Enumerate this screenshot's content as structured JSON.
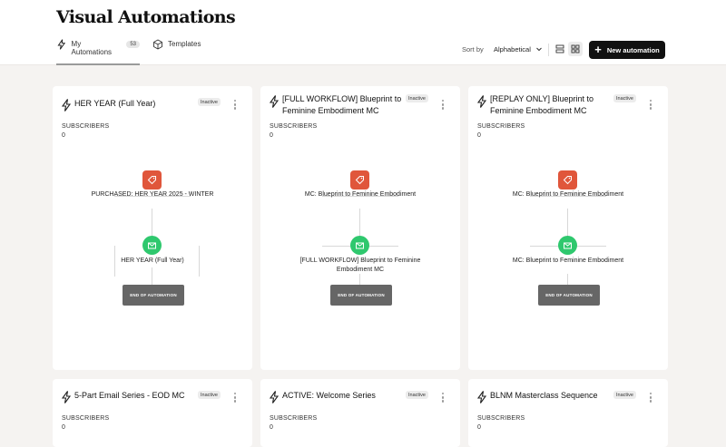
{
  "page": {
    "title": "Visual Automations"
  },
  "tabs": [
    {
      "label": "My Automations",
      "count": "53"
    },
    {
      "label": "Templates"
    }
  ],
  "toolbar": {
    "sort_label": "Sort by",
    "sort_value": "Alphabetical",
    "new_button": "New automation"
  },
  "cards": [
    {
      "title": "HER YEAR (Full Year)",
      "status": "Inactive",
      "subscribers_label": "SUBSCRIBERS",
      "subscribers": "0",
      "trigger": "PURCHASED: HER YEAR 2025 - WINTER",
      "action": "HER YEAR (Full Year)",
      "end": "END OF AUTOMATION"
    },
    {
      "title": "[FULL WORKFLOW] Blueprint to Feminine Embodiment MC",
      "status": "Inactive",
      "subscribers_label": "SUBSCRIBERS",
      "subscribers": "0",
      "trigger": "MC: Blueprint to Feminine Embodiment",
      "action": "[FULL WORKFLOW] Blueprint to Feminine Embodiment MC",
      "end": "END OF AUTOMATION"
    },
    {
      "title": "[REPLAY ONLY] Blueprint to Feminine Embodiment MC",
      "status": "Inactive",
      "subscribers_label": "SUBSCRIBERS",
      "subscribers": "0",
      "trigger": "MC: Blueprint to Feminine Embodiment",
      "action": "MC: Blueprint to Feminine Embodiment",
      "end": "END OF AUTOMATION"
    },
    {
      "title": "5-Part Email Series - EOD MC",
      "status": "Inactive",
      "subscribers_label": "SUBSCRIBERS",
      "subscribers": "0"
    },
    {
      "title": "ACTIVE: Welcome Series",
      "status": "Inactive",
      "subscribers_label": "SUBSCRIBERS",
      "subscribers": "0"
    },
    {
      "title": "BLNM Masterclass Sequence",
      "status": "Inactive",
      "subscribers_label": "SUBSCRIBERS",
      "subscribers": "0"
    }
  ],
  "colors": {
    "trigger": "#e0563b",
    "action": "#2fc86e",
    "primary_button": "#111111",
    "end_node": "#666666"
  },
  "icons": [
    "bolt-icon",
    "cube-icon",
    "chevron-down-icon",
    "list-view-icon",
    "grid-view-icon",
    "plus-icon",
    "tag-icon",
    "email-icon",
    "kebab-menu-icon"
  ]
}
